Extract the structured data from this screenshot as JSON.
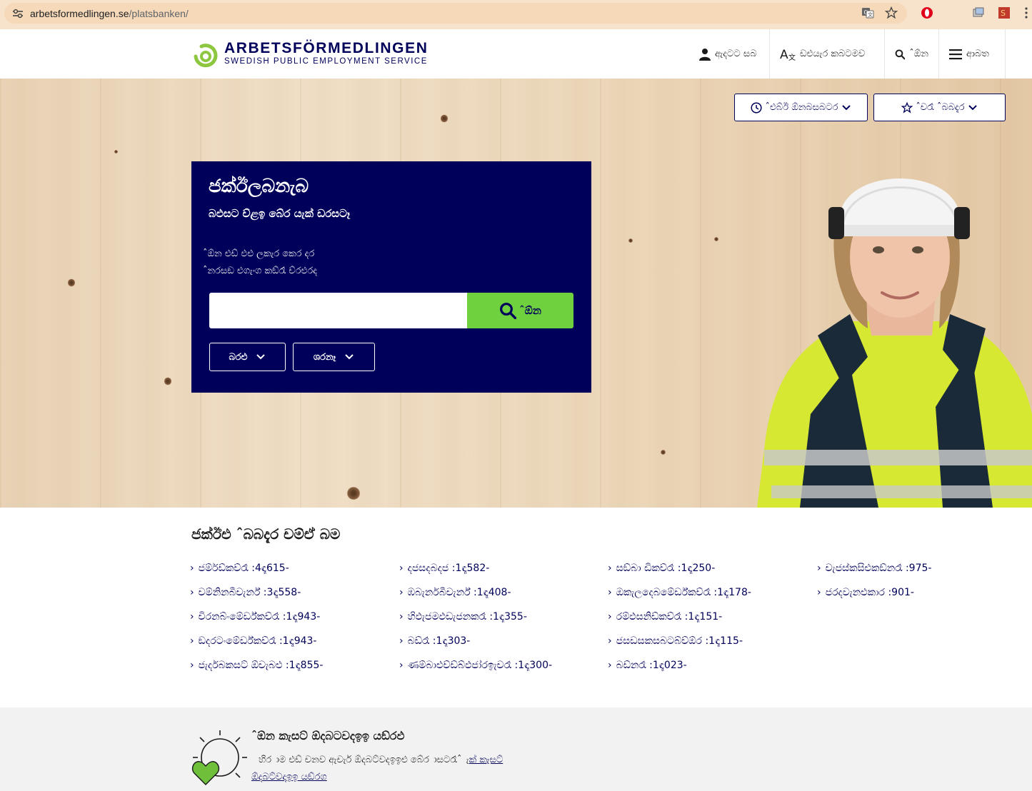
{
  "browser": {
    "url_domain": "arbetsformedlingen.se",
    "url_path": "/platsbanken/"
  },
  "header": {
    "logo_title": "ARBETSFÖRMEDLINGEN",
    "logo_subtitle": "SWEDISH PUBLIC EMPLOYMENT SERVICE",
    "nav": {
      "login": "ඇදටට සබ",
      "language": "ඩඑයැර කබටමව",
      "search": "ˆඕන",
      "menu": "ආබත"
    }
  },
  "hero": {
    "history_btn": "ˆඑබ්ඊ ඕනබසබටර",
    "saved_btn": "ˆචරෑ ˆබබදැර",
    "card_title": "ජක්ඊලබනැබ",
    "card_subtitle": "බඵසට ච්ළඉ බේර යැක් ඩරසටෑ",
    "hint_1": "ˆඕන එඩ් ඵඑ ලකැර කෙර දර",
    "hint_2": "ˆනරසඞ එගැංග කඞ්රෑ ච්රළුරද",
    "search_placeholder": "",
    "search_button": "ˆඕන",
    "filter_1": "බරඑ",
    "filter_2": "ශරනෑ"
  },
  "categories": {
    "title": "ජක්ඊඑ ˆබබදැර චම්ඒ බම",
    "columns": [
      [
        "ජම්ර්ඩ්කච්රෑ :4ඳෑ615-",
        "චම්නිනබීචැර්න් :3ඳෑ558-",
        "චිරනබ්ංමේර්ඩ්කච්රෑ :1ඳෑ943-",
        "ඞදරටංමේර්ඩ්කච්රෑ :1ඳෑ943-",
        "ජැර්දබකසට් ඕචැබඑ :1ඳෑ855-"
      ],
      [
        "දජසදබදජ :1ඳෑ582-",
        "ඹබැර්නබීචැර්න් :1ඳෑ408-",
        "හිඵැජමඵඩැජනකරෑ :1ඳෑ355-",
        "බඩ්රෑ :1ඳෑ303-",
        "ණම්බාඑච්ඩ්බ්ඵජා්රඉැචරෑ :1ඳෑ300-"
      ],
      [
        "සඞ්බා ඩිකච්රෑ :1ඳෑ250-",
        "ඔකැලදෙබමේර්ඩ්කච්රෑ :1ඳෑ178-",
        "රම්ඵසනිඩ්කච්රෑ :1ඳෑ151-",
        "ජසඩසකසබටබ්ච්ඕර :1ඳෑ115-",
        "බඩ්නරෑ :1ඳෑ023-"
      ],
      [
        "චැජස්කසිඑකඞ්නරෑ :975-",
        "ජරදවැනඑකාර :901-"
      ]
    ]
  },
  "bottom": {
    "title": "ˆඕන කැසට් ඕදබටවදඉඉ යඞ්රඵ",
    "text": "හිර ාම එඩ් චනව ඇචැර් ඕදබට්වදඉඉඑ බේර ාසටරෑˆ",
    "link_1": "ැක් කැසට්",
    "link_2": "ඕදබට්වදඉඉ යඞ්රග"
  },
  "colors": {
    "brand_navy": "#00005a",
    "brand_green": "#6fd13e",
    "logo_green": "#8dc63f"
  }
}
